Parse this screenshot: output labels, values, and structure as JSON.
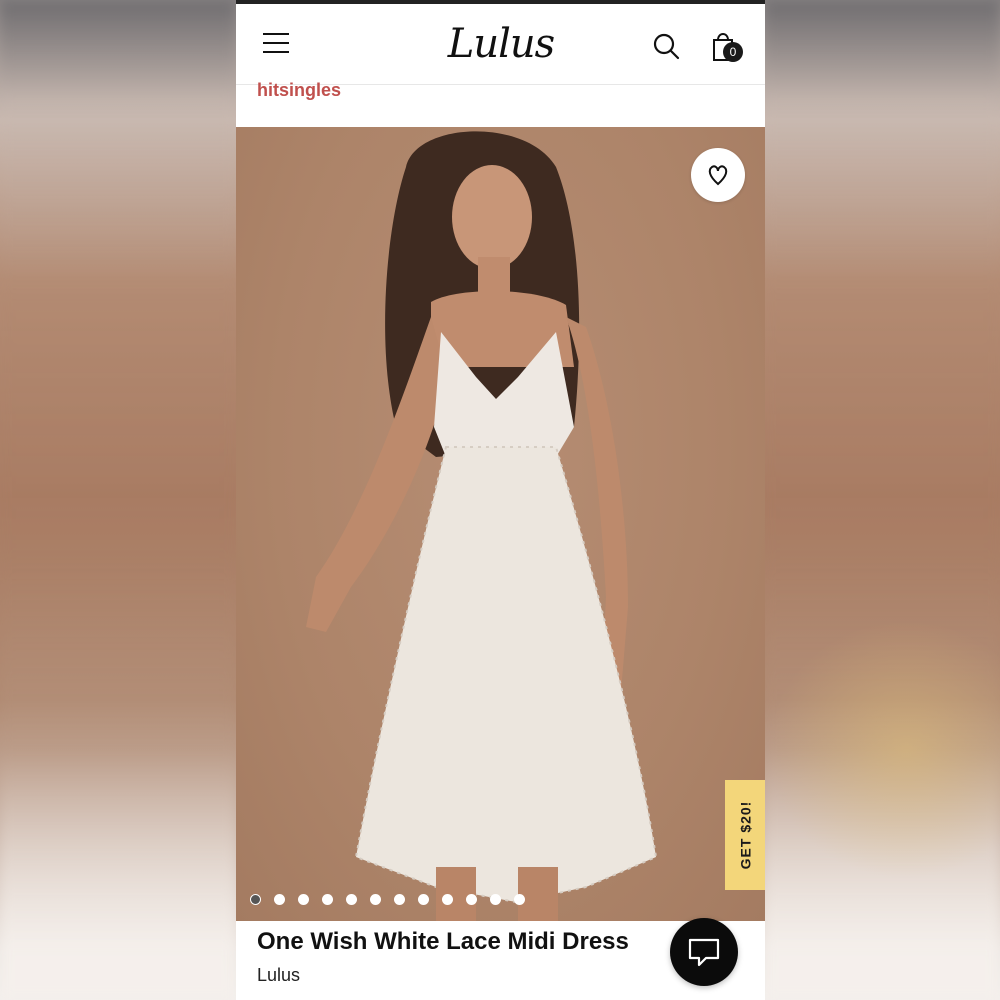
{
  "header": {
    "logo_text": "Lulus",
    "cart_count": "0",
    "icons": [
      "menu-icon",
      "search-icon",
      "shopping-bag-icon"
    ]
  },
  "breadcrumb": {
    "brand_link": "hitsingles"
  },
  "gallery": {
    "image_count": 12,
    "active_index": 0,
    "favorite_icon": "heart-icon",
    "promo_label": "GET $20!"
  },
  "product": {
    "title": "One Wish White Lace Midi Dress",
    "brand": "Lulus"
  },
  "chat": {
    "icon": "chat-bubble-icon"
  },
  "colors": {
    "brand_link": "#c0504d",
    "promo_bg": "#f3d67a",
    "image_bg": "#ad8469"
  }
}
